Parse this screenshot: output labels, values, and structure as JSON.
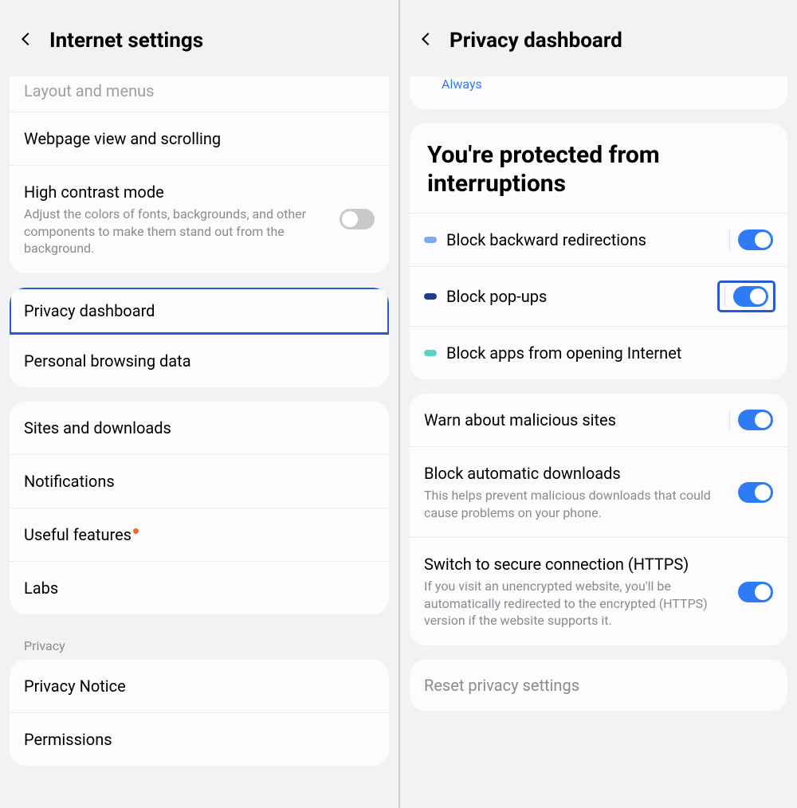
{
  "left": {
    "title": "Internet settings",
    "partial_row": "Layout and menus",
    "rows1": [
      {
        "title": "Webpage view and scrolling",
        "desc": "",
        "toggle": null
      },
      {
        "title": "High contrast mode",
        "desc": "Adjust the colors of fonts, backgrounds, and other components to make them stand out from the background.",
        "toggle": "off"
      }
    ],
    "rows2": [
      {
        "title": "Privacy dashboard",
        "highlighted": true
      },
      {
        "title": "Personal browsing data"
      }
    ],
    "rows3": [
      {
        "title": "Sites and downloads"
      },
      {
        "title": "Notifications"
      },
      {
        "title": "Useful features",
        "dot": true
      },
      {
        "title": "Labs"
      }
    ],
    "section_label": "Privacy",
    "rows4": [
      {
        "title": "Privacy Notice"
      },
      {
        "title": "Permissions"
      }
    ]
  },
  "right": {
    "title": "Privacy dashboard",
    "always": "Always",
    "heading": "You're protected from interruptions",
    "block_rows": [
      {
        "pill": "c1",
        "title": "Block backward redirections",
        "toggle": "on",
        "divider": true
      },
      {
        "pill": "c2",
        "title": "Block pop-ups",
        "toggle": "on",
        "divider": true,
        "highlighted": true
      },
      {
        "pill": "c3",
        "title": "Block apps from opening Internet",
        "toggle": null
      }
    ],
    "more_rows": [
      {
        "title": "Warn about malicious sites",
        "desc": "",
        "toggle": "on",
        "divider": true
      },
      {
        "title": "Block automatic downloads",
        "desc": "This helps prevent malicious downloads that could cause problems on your phone.",
        "toggle": "on"
      },
      {
        "title": "Switch to secure connection (HTTPS)",
        "desc": "If you visit an unencrypted website, you'll be automatically redirected to the encrypted (HTTPS) version if the website supports it.",
        "toggle": "on"
      }
    ],
    "reset": "Reset privacy settings"
  }
}
